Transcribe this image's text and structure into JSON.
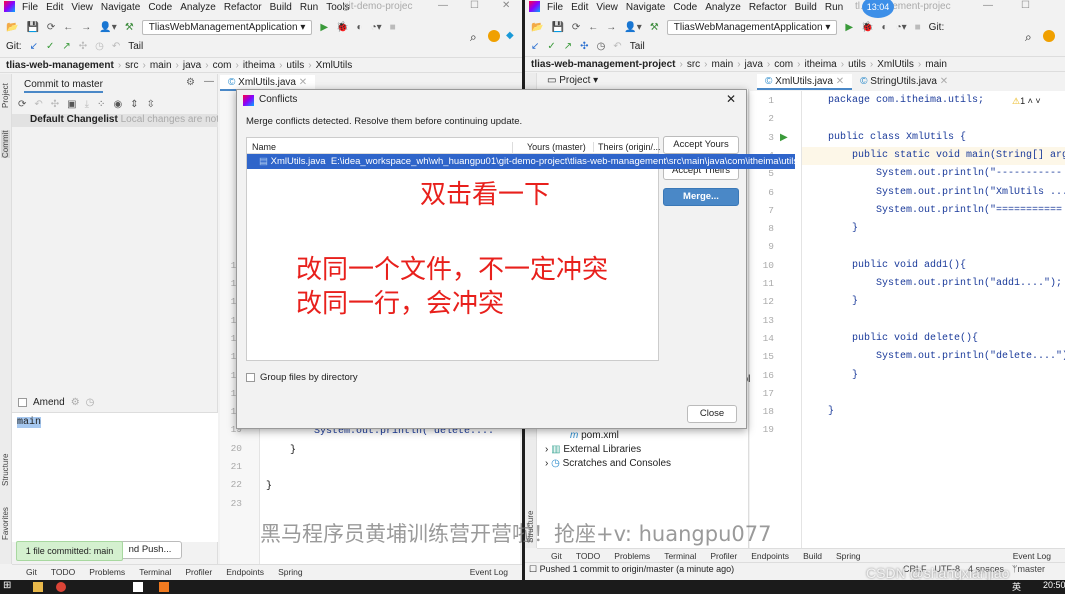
{
  "menu": [
    "File",
    "Edit",
    "View",
    "Navigate",
    "Code",
    "Analyze",
    "Refactor",
    "Build",
    "Run",
    "Tools"
  ],
  "left": {
    "title": "git-demo-projec",
    "run_config": "TliasWebManagementApplication",
    "git_label": "Git:",
    "tail": "Tail",
    "breadcrumb": [
      "tlias-web-management",
      "src",
      "main",
      "java",
      "com",
      "itheima",
      "utils",
      "XmlUtils"
    ],
    "commit_tab": "Commit to master",
    "changelist": "Default Changelist",
    "changelist_note": "Local changes are not ava",
    "amend": "Amend",
    "commit_message": "main",
    "commit_push_btn": "nd Push...",
    "toast": "1 file committed: main",
    "editor_tab": "XmlUtils.java",
    "code_line19": "System.out.println(\"delete....\"",
    "code_line20": "}",
    "code_line22": "}",
    "side_tabs": [
      "Project",
      "Commit",
      "Structure",
      "Favorites"
    ],
    "tool_tabs": [
      "Git",
      "TODO",
      "Problems",
      "Terminal",
      "Profiler",
      "Endpoints",
      "Spring"
    ],
    "event_log": "Event Log"
  },
  "right": {
    "title": "tl…anagement-projec",
    "clock": "13:04",
    "run_config": "TliasWebManagementApplication",
    "git_label": "Git:",
    "tail": "Tail",
    "breadcrumb": [
      "tlias-web-management-project",
      "src",
      "main",
      "java",
      "com",
      "itheima",
      "utils",
      "XmlUtils",
      "main"
    ],
    "project_tab": "Project",
    "editor_tabs": [
      "XmlUtils.java",
      "StringUtils.java"
    ],
    "warning_count": "1",
    "tree": [
      "pom.xml",
      "External Libraries",
      "Scratches and Consoles"
    ],
    "tree_partial": "opl",
    "tool_tabs": [
      "Git",
      "TODO",
      "Problems",
      "Terminal",
      "Profiler",
      "Endpoints",
      "Build",
      "Spring"
    ],
    "event_log": "Event Log",
    "status": "Pushed 1 commit to origin/master (a minute ago)",
    "status_right": [
      "CRLF",
      "UTF-8",
      "4 spaces",
      "master"
    ],
    "code": [
      [
        "package com.itheima.utils;"
      ],
      [
        ""
      ],
      [
        "public class XmlUtils {"
      ],
      [
        "    public static void main(String[] args)"
      ],
      [
        "        System.out.println(\"-----------"
      ],
      [
        "        System.out.println(\"XmlUtils ....."
      ],
      [
        "        System.out.println(\"==========="
      ],
      [
        "    }"
      ],
      [
        ""
      ],
      [
        "    public void add1(){"
      ],
      [
        "        System.out.println(\"add1....\");"
      ],
      [
        "    }"
      ],
      [
        ""
      ],
      [
        "    public void delete(){"
      ],
      [
        "        System.out.println(\"delete....\");"
      ],
      [
        "    }"
      ],
      [
        ""
      ],
      [
        "}"
      ],
      [
        ""
      ]
    ]
  },
  "dialog": {
    "title": "Conflicts",
    "message": "Merge conflicts detected. Resolve them before continuing update.",
    "columns": [
      "Name",
      "Yours (master)",
      "Theirs (origin/..."
    ],
    "rows": [
      {
        "file": "XmlUtils.java",
        "path": "E:\\idea_workspace_wh\\wh_huangpu01\\git-demo-project\\tlias-web-management\\src\\main\\java\\com\\itheima\\utils"
      }
    ],
    "accept_yours": "Accept Yours",
    "accept_theirs": "Accept Theirs",
    "merge": "Merge...",
    "group_by_dir": "Group files by directory",
    "close": "Close"
  },
  "overlay": {
    "annotation1": "双击看一下",
    "annotation2": "改同一个文件，不一定冲突",
    "annotation3": "改同一行，会冲突",
    "watermark": "黑马程序员黄埔训练营开营啦！抢座+v: huangpu077",
    "csdn": "CSDN @shangxianjiao"
  },
  "taskbar": {
    "time": "20:50",
    "ime": "英"
  },
  "colors": {
    "selection": "#2f65ca",
    "merge_button": "#4a88c7",
    "annotation": "#e8201c",
    "toast": "#d4f0cf"
  }
}
